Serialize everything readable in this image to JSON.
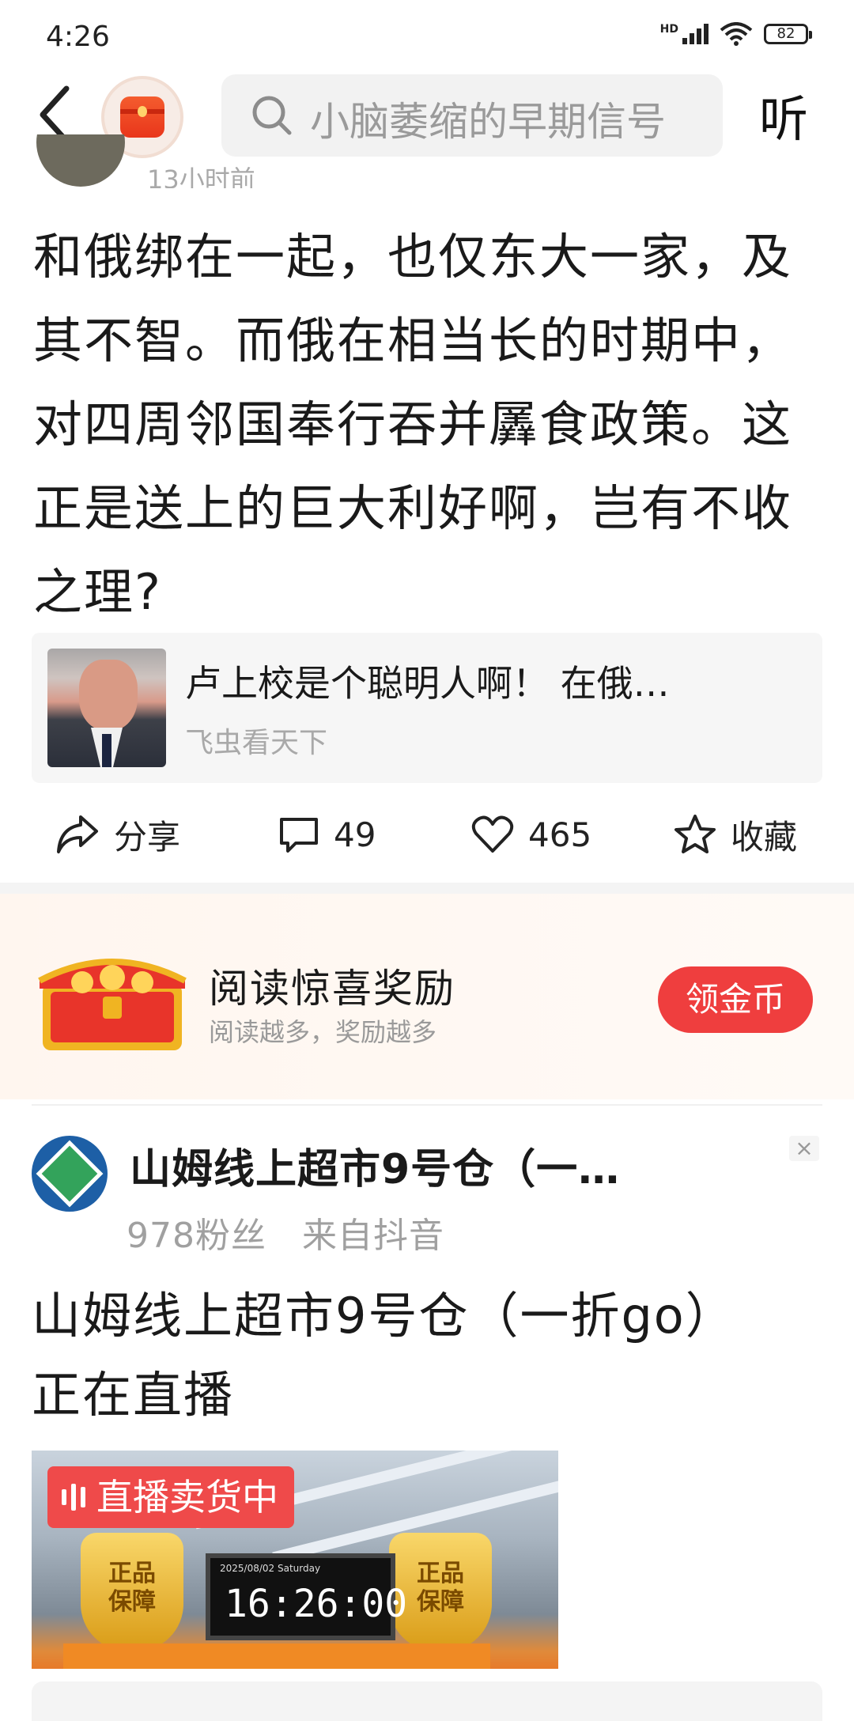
{
  "status_bar": {
    "time": "4:26",
    "battery": "82",
    "network": "HD"
  },
  "header": {
    "search_placeholder": "小脑萎缩的早期信号",
    "listen_label": "听"
  },
  "article": {
    "post_time": "13小时前",
    "body": "和俄绑在一起，也仅东大一家，及其不智。而俄在相当长的时期中，对四周邻国奉行吞并羼食政策。这正是送上的巨大利好啊，岂有不收之理?",
    "quote": {
      "title": "卢上校是个聪明人啊！ 在俄…",
      "source": "飞虫看天下"
    },
    "actions": {
      "share_label": "分享",
      "comment_count": "49",
      "like_count": "465",
      "favorite_label": "收藏"
    }
  },
  "reward": {
    "title": "阅读惊喜奖励",
    "subtitle": "阅读越多，奖励越多",
    "button_label": "领金币"
  },
  "live_post": {
    "account_name": "山姆线上超市9号仓（一…",
    "meta": "978粉丝   来自抖音",
    "headline": "山姆线上超市9号仓（一折go）正在直播",
    "badge_label": "直播卖货中",
    "shield_text": "正品保障",
    "clock_date": "2025/08/02  Saturday",
    "clock_time": "16:26:00"
  },
  "colors": {
    "accent_red": "#ef3e3e",
    "brand_orange": "#f45c2e"
  }
}
